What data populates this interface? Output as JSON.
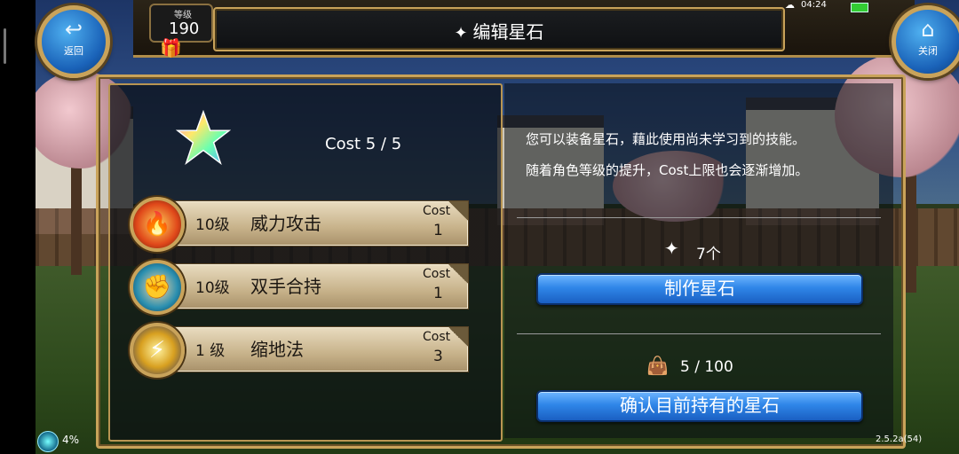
{
  "top": {
    "title": "编辑星石",
    "level_label": "等级",
    "level_value": "190",
    "back_label": "返回",
    "close_label": "关闭",
    "time": "04:24"
  },
  "left": {
    "cost_text": "Cost 5 / 5",
    "skills": [
      {
        "level": "10级",
        "name": "威力攻击",
        "cost_label": "Cost",
        "cost": "1",
        "icon": "fire-icon"
      },
      {
        "level": "10级",
        "name": "双手合持",
        "cost_label": "Cost",
        "cost": "1",
        "icon": "fist-icon"
      },
      {
        "level": "1 级",
        "name": "缩地法",
        "cost_label": "Cost",
        "cost": "3",
        "icon": "dash-icon"
      }
    ]
  },
  "right": {
    "info_line1": "您可以装备星石，藉此使用尚未学习到的技能。",
    "info_line2": "随着角色等级的提升，Cost上限也会逐渐增加。",
    "stone_count": "7个",
    "craft_button": "制作星石",
    "bag_count": "5 / 100",
    "confirm_button": "确认目前持有的星石"
  },
  "bottom": {
    "percent": "4%",
    "version": "2.5.2a(54)"
  },
  "colors": {
    "frame_gold": "#c9a35a",
    "button_blue": "#2f86e8",
    "plate_beige": "#d8c7a2"
  }
}
